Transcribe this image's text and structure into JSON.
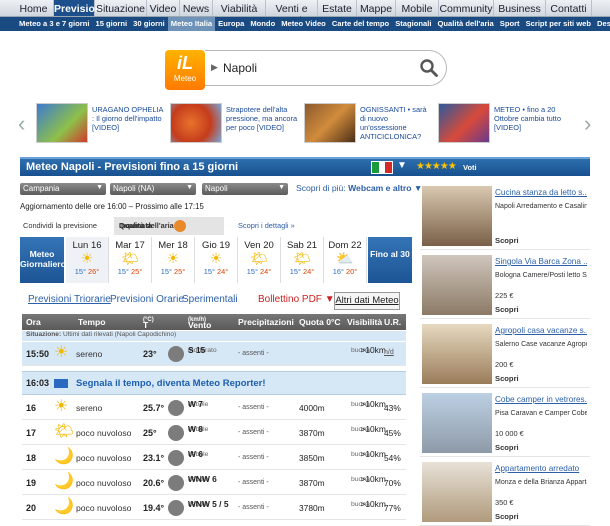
{
  "topnav": [
    "Home",
    "Previsioni",
    "Situazione",
    "Video",
    "News",
    "Viabilità",
    "Venti e Mari",
    "Estate",
    "Mappe",
    "Mobile",
    "Community",
    "Business",
    "Contatti"
  ],
  "subnav": [
    "Meteo a 3 e 7 giorni",
    "15 giorni",
    "30 giorni",
    "Meteo Italia",
    "Europa",
    "Mondo",
    "Meteo Video",
    "Carte del tempo",
    "Stagionali",
    "Qualità dell'aria",
    "Sport",
    "Script per siti web",
    "Desktop"
  ],
  "logo": {
    "big": "iL",
    "small": "Meteo"
  },
  "search": {
    "value": "Napoli"
  },
  "news": [
    {
      "text": "URAGANO OPHELIA : Il giorno dell'impatto [VIDEO]"
    },
    {
      "text": "Strapotere dell'alta pressione, ma ancora per poco [VIDEO]"
    },
    {
      "text": "OGNISSANTI • sarà di nuovo un'ossessione ANTICICLONICA?"
    },
    {
      "text": "METEO • fino a 20 Ottobre cambia tutto [VIDEO]"
    }
  ],
  "title": "Meteo Napoli - Previsioni fino a 15 giorni",
  "rating": {
    "stars": "★★★★★",
    "label": "Voti"
  },
  "selects": [
    "Campania",
    "Napoli (NA)",
    "Napoli"
  ],
  "scopri": {
    "prefix": "Scopri di più: ",
    "link": "Webcam e altro"
  },
  "aggiornamento": "Aggiornamento delle ore 16:00 – Prossimo alle 17:15",
  "actions": {
    "condividi": "Condividi la previsione",
    "qualita": "Qualità dell'aria",
    "inquinata": "Inquinata",
    "dettagli": "Scopri i dettagli »"
  },
  "days": {
    "left": "Meteo Giornaliero",
    "right": "Fino al 30",
    "list": [
      {
        "name": "Lun 16",
        "icon": "☀",
        "min": "15°",
        "max": "26°"
      },
      {
        "name": "Mar 17",
        "icon": "🌤",
        "min": "15°",
        "max": "25°"
      },
      {
        "name": "Mer 18",
        "icon": "☀",
        "min": "15°",
        "max": "25°"
      },
      {
        "name": "Gio 19",
        "icon": "☀",
        "min": "15°",
        "max": "24°"
      },
      {
        "name": "Ven 20",
        "icon": "🌤",
        "min": "15°",
        "max": "24°"
      },
      {
        "name": "Sab 21",
        "icon": "🌤",
        "min": "15°",
        "max": "24°"
      },
      {
        "name": "Dom 22",
        "icon": "⛅",
        "min": "16°",
        "max": "20°"
      }
    ]
  },
  "tabs": {
    "triorarie": "Previsioni Triorarie",
    "orarie": "Previsioni Orarie",
    "sperimentali": "Sperimentali",
    "pdf": "Bollettino PDF ▼",
    "altri": "Altri dati Meteo"
  },
  "table": {
    "headers": {
      "ora": "Ora",
      "tempo": "Tempo",
      "t": "T",
      "t_unit": "(°C)",
      "vento": "Vento",
      "vento_unit": "(km/h)",
      "prec": "Precipitazioni",
      "zero": "Quota 0°C",
      "vis": "Visibilità",
      "uv": "U.R."
    },
    "situazione_label": "Situazione:",
    "situazione": " Ultimi dati rilevati (Napoli Capodichino)",
    "obs": {
      "ora": "15:50",
      "icon": "☀",
      "tempo": "sereno",
      "t": "23°",
      "wind": "S 15",
      "wind_desc": "moderato",
      "prec": "- assenti -",
      "zero": "",
      "vis": ">10km",
      "vis_desc": "buona",
      "uv": "n/d"
    },
    "reporter": {
      "ora": "16:03",
      "text": "Segnala il tempo, diventa Meteo Reporter!"
    },
    "rows": [
      {
        "ora": "16",
        "icon": "☀",
        "tempo": "sereno",
        "t": "25.7°",
        "wind": "W 7",
        "wind_desc": "debole",
        "prec": "- assenti -",
        "zero": "4000m",
        "vis": ">10km",
        "vis_desc": "buona",
        "uv": "43%"
      },
      {
        "ora": "17",
        "icon": "🌤",
        "tempo": "poco nuvoloso",
        "t": "25°",
        "wind": "W 8",
        "wind_desc": "debole",
        "prec": "- assenti -",
        "zero": "3870m",
        "vis": ">10km",
        "vis_desc": "buona",
        "uv": "45%"
      },
      {
        "ora": "18",
        "icon": "🌙",
        "tempo": "poco nuvoloso",
        "t": "23.1°",
        "wind": "W 6",
        "wind_desc": "debole",
        "prec": "- assenti -",
        "zero": "3850m",
        "vis": ">10km",
        "vis_desc": "buona",
        "uv": "54%"
      },
      {
        "ora": "19",
        "icon": "🌙",
        "tempo": "poco nuvoloso",
        "t": "20.6°",
        "wind": "WNW 6",
        "wind_desc": "debole",
        "prec": "- assenti -",
        "zero": "3870m",
        "vis": ">10km",
        "vis_desc": "buona",
        "uv": "70%"
      },
      {
        "ora": "20",
        "icon": "🌙",
        "tempo": "poco nuvoloso",
        "t": "19.4°",
        "wind": "WNW 5 / 5",
        "wind_desc": "debole",
        "prec": "- assenti -",
        "zero": "3780m",
        "vis": ">10km",
        "vis_desc": "buona",
        "uv": "77%"
      }
    ]
  },
  "ads": [
    {
      "title": "Cucina stanza da letto s...",
      "desc": "Napoli Arredamento e Casalinghi Cucina stanza da ...",
      "price": "",
      "cta": "Scopri"
    },
    {
      "title": "Singola Via Barca Zona ...",
      "desc": "Bologna Camere/Posti letto Singola Via Barca Zona Villa...",
      "price": "225 €",
      "cta": "Scopri"
    },
    {
      "title": "Agropoli casa vacanze s...",
      "desc": "Salerno Case vacanze Agropoli casa vacanze s...",
      "price": "200 €",
      "cta": "Scopri"
    },
    {
      "title": "Cobe camper in vetrores...",
      "desc": "Pisa Caravan e Camper Cobe camper in vetroresina su ...",
      "price": "10 000 €",
      "cta": "Scopri"
    },
    {
      "title": "Appartamento arredato",
      "desc": "Monza e della Brianza Appartamenti Appartamento arre...",
      "price": "350 €",
      "cta": "Scopri"
    }
  ],
  "colors": {
    "nav_active": "#1d4f8c",
    "subnav_bg": "#1a4a82",
    "title_bar": "#17508f",
    "accent_orange": "#ff7a00",
    "link": "#2b5fa8"
  }
}
